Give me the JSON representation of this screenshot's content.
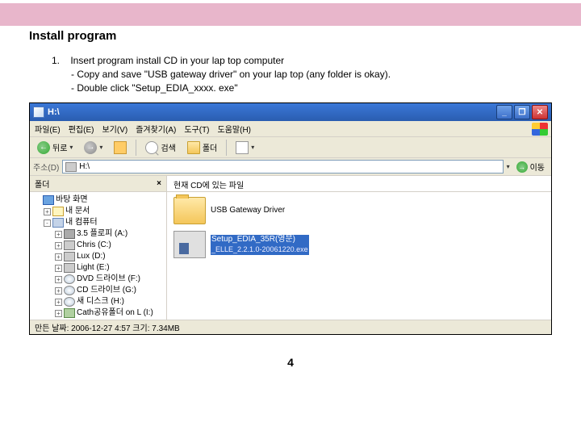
{
  "section_title": "Install program",
  "instructions": {
    "number": "1.",
    "main": "Insert program install CD in your lap top computer",
    "sub1": "- Copy and save \"USB gateway driver\" on your lap top (any folder is okay).",
    "sub2": "- Double click \"Setup_EDIA_xxxx. exe\""
  },
  "window": {
    "title": "H:\\",
    "menus": [
      "파일(E)",
      "편집(E)",
      "보기(V)",
      "즐겨찾기(A)",
      "도구(T)",
      "도움말(H)"
    ],
    "toolbar": {
      "back": "뒤로",
      "search": "검색",
      "folders": "폴더"
    },
    "address": {
      "label": "주소(D)",
      "value": "H:\\",
      "go": "이동"
    },
    "sidepanel": {
      "title": "폴더",
      "items": [
        {
          "label": "바탕 화면",
          "icon": "desktop",
          "indent": 0,
          "exp": ""
        },
        {
          "label": "내 문서",
          "icon": "docs",
          "indent": 1,
          "exp": "+"
        },
        {
          "label": "내 컴퓨터",
          "icon": "comp",
          "indent": 1,
          "exp": "-"
        },
        {
          "label": "3.5 플로피 (A:)",
          "icon": "floppy",
          "indent": 2,
          "exp": "+"
        },
        {
          "label": "Chris (C:)",
          "icon": "disk",
          "indent": 2,
          "exp": "+"
        },
        {
          "label": "Lux (D:)",
          "icon": "disk",
          "indent": 2,
          "exp": "+"
        },
        {
          "label": "Light (E:)",
          "icon": "disk",
          "indent": 2,
          "exp": "+"
        },
        {
          "label": "DVD 드라이브 (F:)",
          "icon": "cd",
          "indent": 2,
          "exp": "+"
        },
        {
          "label": "CD 드라이브 (G:)",
          "icon": "cd",
          "indent": 2,
          "exp": "+"
        },
        {
          "label": "새 디스크 (H:)",
          "icon": "cd",
          "indent": 2,
          "exp": "+"
        },
        {
          "label": "Cath공유폴더 on L (I:)",
          "icon": "net",
          "indent": 2,
          "exp": "+"
        }
      ]
    },
    "content": {
      "header": "현재 CD에 있는 파일",
      "items": [
        {
          "name": "USB Gateway Driver",
          "sub": "",
          "kind": "folder",
          "selected": false
        },
        {
          "name": "Setup_EDIA_35R(영문)",
          "sub": "_ELLE_2.2.1.0-20061220.exe",
          "kind": "setup",
          "selected": true
        }
      ]
    },
    "statusbar": "만든 날짜: 2006-12-27  4:57  크기: 7.34MB"
  },
  "page_number": "4"
}
